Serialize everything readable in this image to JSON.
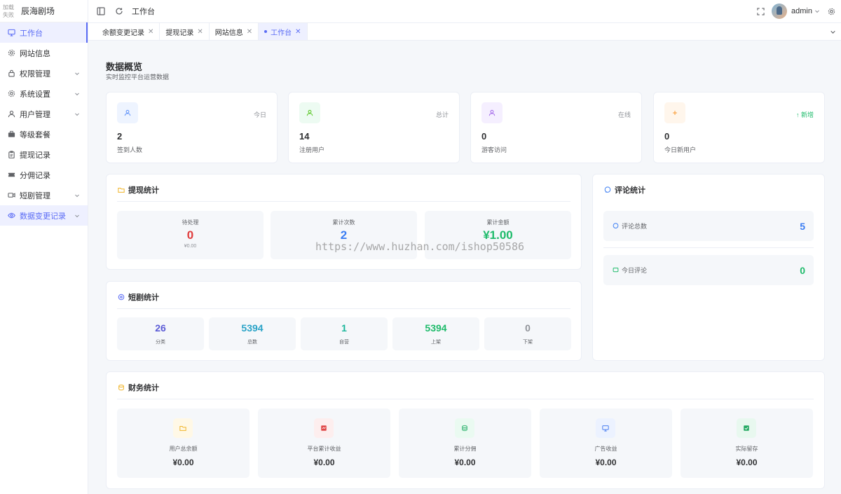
{
  "brand": {
    "logo_line1": "加载",
    "logo_line2": "失败",
    "name": "辰海剧场"
  },
  "sidebar": {
    "items": [
      {
        "label": "工作台",
        "icon": "monitor-icon",
        "has_arrow": false
      },
      {
        "label": "网站信息",
        "icon": "gear-icon",
        "has_arrow": false
      },
      {
        "label": "权限管理",
        "icon": "lock-icon",
        "has_arrow": true
      },
      {
        "label": "系统设置",
        "icon": "gear-icon",
        "has_arrow": true
      },
      {
        "label": "用户管理",
        "icon": "user-icon",
        "has_arrow": true
      },
      {
        "label": "等级套餐",
        "icon": "briefcase-icon",
        "has_arrow": false
      },
      {
        "label": "提现记录",
        "icon": "clipboard-icon",
        "has_arrow": false
      },
      {
        "label": "分佣记录",
        "icon": "ticket-icon",
        "has_arrow": false
      },
      {
        "label": "短剧管理",
        "icon": "video-icon",
        "has_arrow": true
      },
      {
        "label": "数据变更记录",
        "icon": "eye-icon",
        "has_arrow": true
      }
    ]
  },
  "topbar": {
    "title": "工作台",
    "user": "admin"
  },
  "tabs": [
    {
      "label": "余额变更记录"
    },
    {
      "label": "提现记录"
    },
    {
      "label": "网站信息"
    },
    {
      "label": "工作台"
    }
  ],
  "page": {
    "title": "数据概览",
    "subtitle": "实时监控平台运营数据"
  },
  "stats": [
    {
      "value": "2",
      "label": "签到人数",
      "tag": "今日",
      "icon": "user-icon",
      "color": "#5b8ff9",
      "bg": "#eef4ff"
    },
    {
      "value": "14",
      "label": "注册用户",
      "tag": "总计",
      "icon": "user-icon",
      "color": "#52c41a",
      "bg": "#edfbf2"
    },
    {
      "value": "0",
      "label": "游客访问",
      "tag": "在线",
      "icon": "user-icon",
      "color": "#a064e8",
      "bg": "#f5efff"
    },
    {
      "value": "0",
      "label": "今日新用户",
      "tag": "新增",
      "tag_arrow": "↑",
      "icon": "plus-icon",
      "color": "#fa8c16",
      "bg": "#fff6ec"
    }
  ],
  "withdraw": {
    "title": "提现统计",
    "items": [
      {
        "label": "待处理",
        "value": "0",
        "sub": "¥0.00",
        "color": "#e03d3d"
      },
      {
        "label": "累计次数",
        "value": "2",
        "color": "#3c7ef3"
      },
      {
        "label": "累计金额",
        "value": "¥1.00",
        "color": "#1fbb6b"
      }
    ]
  },
  "comments": {
    "title": "评论统计",
    "items": [
      {
        "label": "评论总数",
        "value": "5",
        "color": "#3c7ef3"
      },
      {
        "label": "今日评论",
        "value": "0",
        "color": "#1fbb6b"
      }
    ]
  },
  "drama": {
    "title": "短剧统计",
    "items": [
      {
        "label": "分类",
        "value": "26",
        "color": "#5b5bd6"
      },
      {
        "label": "总数",
        "value": "5394",
        "color": "#2aa3c7"
      },
      {
        "label": "自营",
        "value": "1",
        "color": "#1cb69b"
      },
      {
        "label": "上架",
        "value": "5394",
        "color": "#1fbb6b"
      },
      {
        "label": "下架",
        "value": "0",
        "color": "#909399"
      }
    ]
  },
  "finance": {
    "title": "财务统计",
    "items": [
      {
        "label": "用户总余额",
        "value": "¥0.00",
        "icon": "folder-icon",
        "color": "#f0b429",
        "bg": "#fff8e6"
      },
      {
        "label": "平台累计收益",
        "value": "¥0.00",
        "icon": "chart-icon",
        "color": "#e04848",
        "bg": "#fdeeee"
      },
      {
        "label": "累计分佣",
        "value": "¥0.00",
        "icon": "coins-icon",
        "color": "#3cb878",
        "bg": "#eafaf1"
      },
      {
        "label": "广告收益",
        "value": "¥0.00",
        "icon": "ad-icon",
        "color": "#4a7ef0",
        "bg": "#ecf2ff"
      },
      {
        "label": "实际留存",
        "value": "¥0.00",
        "icon": "check-icon",
        "color": "#22a861",
        "bg": "#e8f8ef"
      }
    ]
  },
  "watermark": "https://www.huzhan.com/ishop50586"
}
